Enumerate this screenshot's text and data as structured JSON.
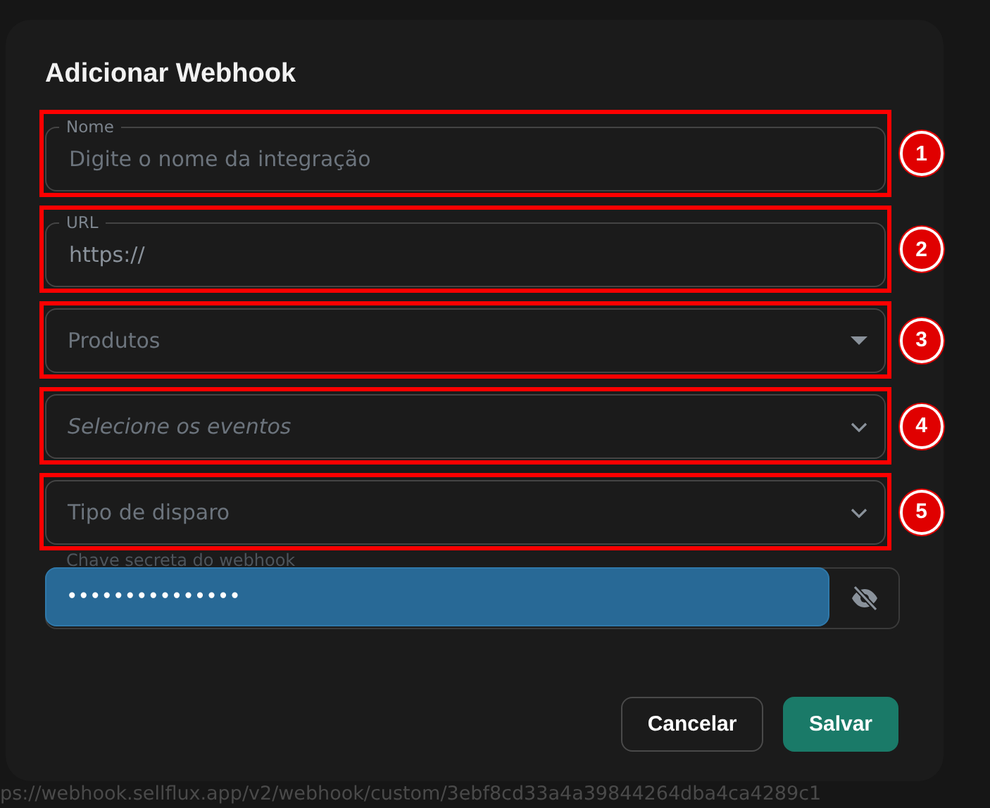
{
  "dialog": {
    "title": "Adicionar Webhook",
    "fields": [
      {
        "kind": "text",
        "label": "Nome",
        "placeholder": "Digite o nome da integração",
        "annotation": "1"
      },
      {
        "kind": "text",
        "label": "URL",
        "value": "https://",
        "annotation": "2"
      },
      {
        "kind": "select",
        "placeholder": "Produtos",
        "annotation": "3"
      },
      {
        "kind": "multiselect",
        "placeholder": "Selecione os eventos",
        "annotation": "4"
      },
      {
        "kind": "dropdown",
        "placeholder": "Tipo de disparo",
        "annotation": "5"
      }
    ],
    "secret": {
      "label": "Chave secreta do webhook",
      "value": "•••••••••••••••"
    },
    "buttons": [
      {
        "label": "Cancelar",
        "kind": "secondary"
      },
      {
        "label": "Salvar",
        "kind": "primary"
      }
    ]
  },
  "background_url": "ps://webhook.sellflux.app/v2/webhook/custom/3ebf8cd33a4a39844264dba4ca4289c1"
}
